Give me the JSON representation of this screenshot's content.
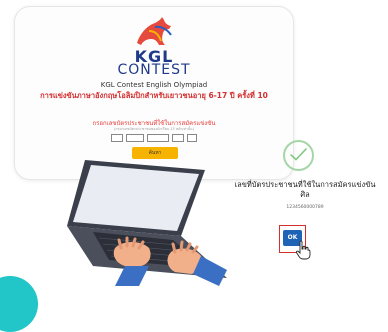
{
  "form": {
    "brand_top": "KGL",
    "brand_bottom": "CONTEST",
    "subtitle_en": "KGL Contest English Olympiad",
    "subtitle_th": "การแข่งขันภาษาอังกฤษโอลิมปิกสำหรับเยาวชนอายุ 6-17 ปี ครั้งที่ 10",
    "id_label": "กรอกเลขบัตรประชาชนที่ใช้ในการสมัครแข่งขัน",
    "id_hint": "(กรอกเลขบัตรประชาชนของนักเรียน 13 หลักเท่านั้น)",
    "search_label": "ค้นหา"
  },
  "result": {
    "title": "เลขที่บัตรประชาชนที่ใช้ในการสมัครแข่งขัน ศิล",
    "id_number": "1234560000789",
    "ok_label": "OK"
  },
  "colors": {
    "brand_blue": "#1f3a8a",
    "accent_red": "#d32f2f",
    "button_yellow": "#f6b300",
    "ok_blue": "#1e63b6",
    "success_green": "#81c784",
    "teal": "#22c5c8"
  },
  "icons": [
    "kangaroo-logo-icon",
    "check-circle-icon",
    "hand-pointer-icon",
    "laptop-hands-illustration"
  ]
}
